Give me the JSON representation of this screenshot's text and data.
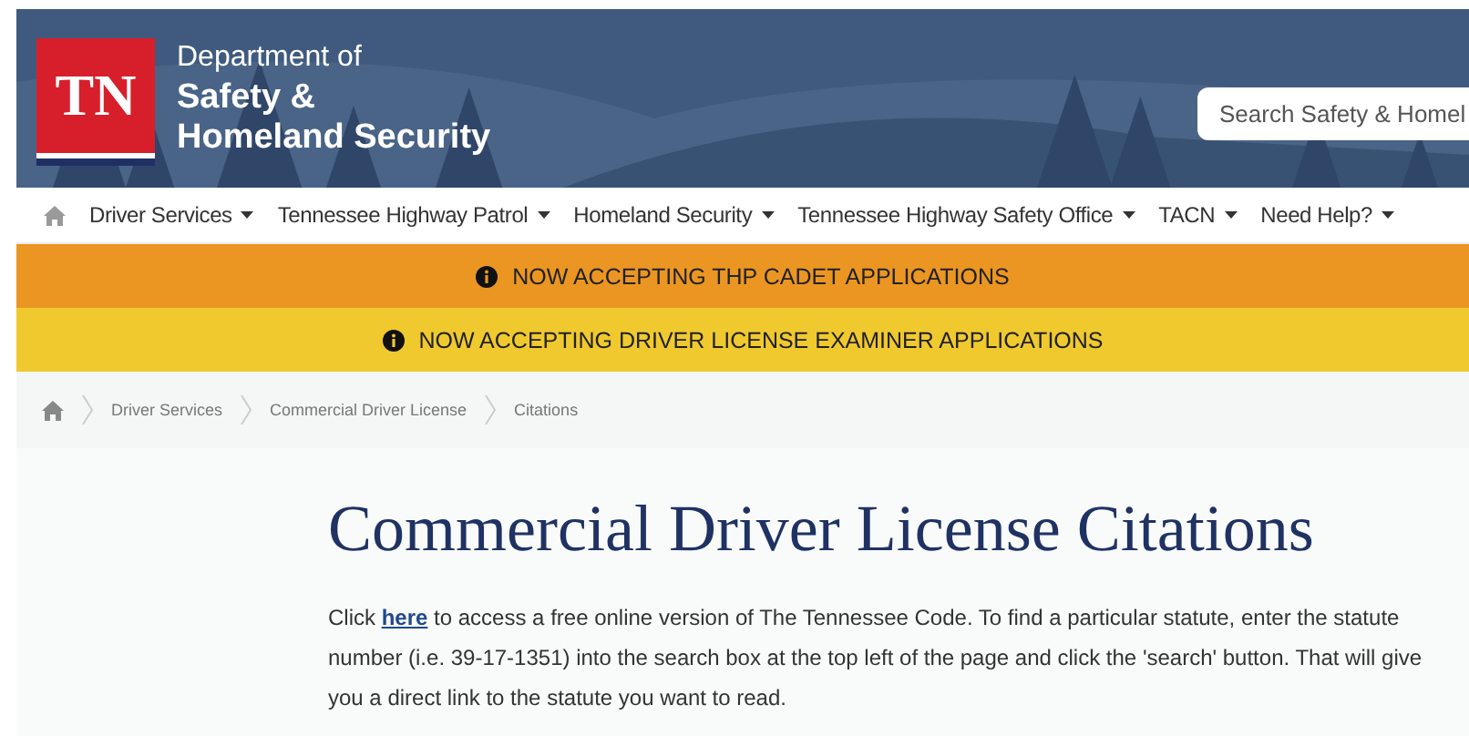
{
  "header": {
    "logo": "TN",
    "department": "Department of",
    "name_line_1": "Safety &",
    "name_line_2": "Homeland Security",
    "search": {
      "placeholder": "Search Safety & Homel"
    }
  },
  "nav": [
    {
      "label": "Driver Services"
    },
    {
      "label": "Tennessee Highway Patrol"
    },
    {
      "label": "Homeland Security"
    },
    {
      "label": "Tennessee Highway Safety Office"
    },
    {
      "label": "TACN"
    },
    {
      "label": "Need Help?"
    }
  ],
  "banners": [
    {
      "text": "NOW ACCEPTING THP CADET APPLICATIONS",
      "color": "#eb9622"
    },
    {
      "text": "NOW ACCEPTING DRIVER LICENSE EXAMINER APPLICATIONS",
      "color": "#f0c92f"
    }
  ],
  "breadcrumb": [
    "Driver Services",
    "Commercial Driver License",
    "Citations"
  ],
  "page": {
    "title": "Commercial Driver License Citations",
    "intro_before": "Click ",
    "intro_link": "here",
    "intro_after": " to access a free online version of The Tennessee Code. To find a particular statute, enter the statute number (i.e. 39-17-1351) into the search box at the top left of the page and click the 'search' button. That will give you a direct link to the statute you want to read."
  }
}
